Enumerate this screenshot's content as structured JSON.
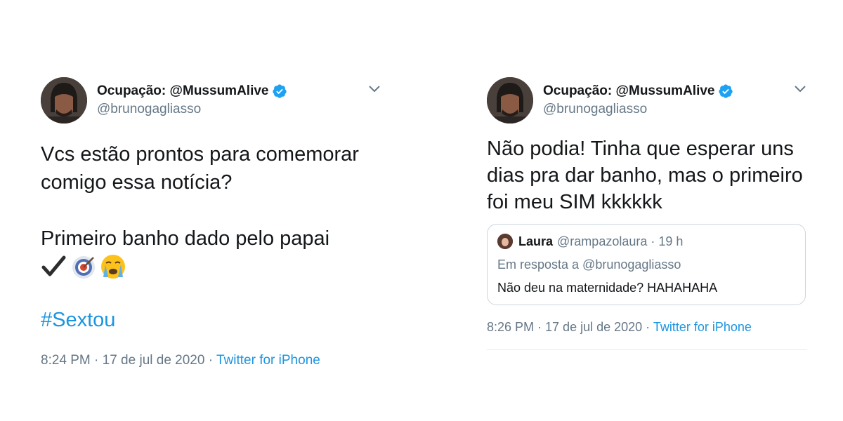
{
  "tweets": [
    {
      "display_name": "Ocupação: @MussumAlive",
      "handle": "@brunogagliasso",
      "text_paragraph_1": "Vcs estão prontos para comemorar comigo essa notícia?",
      "text_paragraph_2": "Primeiro banho dado pelo papai",
      "emojis": [
        "heavy-check-mark",
        "direct-hit",
        "loudly-crying-face"
      ],
      "hashtag": "#Sextou",
      "time": "8:24 PM · 17 de jul de 2020 · ",
      "source": "Twitter for iPhone"
    },
    {
      "display_name": "Ocupação: @MussumAlive",
      "handle": "@brunogagliasso",
      "text": "Não podia! Tinha que esperar uns dias pra dar banho, mas o primeiro foi meu SIM kkkkkk",
      "quoted": {
        "name": "Laura",
        "handle_time": "@rampazolaura · 19 h",
        "reply_to": "Em resposta a @brunogagliasso",
        "text": "Não deu na maternidade? HAHAHAHA"
      },
      "time": "8:26 PM · 17 de jul de 2020 · ",
      "source": "Twitter for iPhone"
    }
  ],
  "colors": {
    "link_blue": "#1b95e0",
    "secondary_text": "#657786",
    "primary_text": "#14171a",
    "verified_blue": "#1da1f2"
  }
}
